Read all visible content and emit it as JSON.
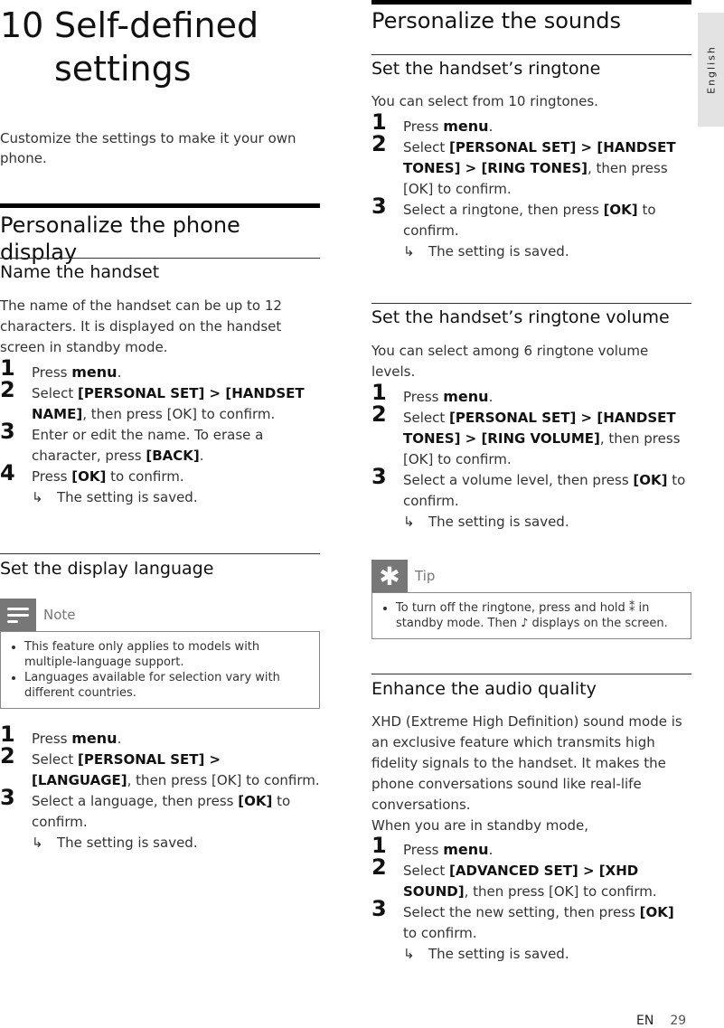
{
  "side_tab": "English",
  "footer": {
    "lang": "EN",
    "page": "29"
  },
  "chapter": {
    "number": "10",
    "title": "Self-defined settings",
    "intro": "Customize the settings to make it your own phone."
  },
  "display": {
    "heading": "Personalize the phone display",
    "name_handset": {
      "heading": "Name the handset",
      "desc": "The name of the handset can be up to 12 characters. It is displayed on the handset screen in standby mode.",
      "steps": [
        {
          "n": "1",
          "pre": "Press ",
          "key": "menu",
          "post": "."
        },
        {
          "n": "2",
          "pre": "Select ",
          "key": "[PERSONAL SET] > [HANDSET NAME]",
          "post": ", then press [OK] to confirm."
        },
        {
          "n": "3",
          "pre": "Enter or edit the name. To erase a character, press ",
          "key": "[BACK]",
          "post": "."
        },
        {
          "n": "4",
          "pre": "Press ",
          "key": "[OK]",
          "post": " to confirm."
        }
      ],
      "result": "The setting is saved."
    },
    "language": {
      "heading": "Set the display language",
      "note_label": "Note",
      "notes": [
        "This feature only applies to models with multiple-language support.",
        "Languages available for selection vary with different countries."
      ],
      "steps": [
        {
          "n": "1",
          "pre": "Press ",
          "key": "menu",
          "post": "."
        },
        {
          "n": "2",
          "pre": "Select ",
          "key": "[PERSONAL SET] > [LANGUAGE]",
          "post": ", then press [OK] to confirm."
        },
        {
          "n": "3",
          "pre": "Select a language, then press ",
          "key": "[OK]",
          "post": " to confirm."
        }
      ],
      "result": "The setting is saved."
    }
  },
  "sounds": {
    "heading": "Personalize the sounds",
    "ringtone": {
      "heading": "Set the handset’s ringtone",
      "desc": "You can select from 10 ringtones.",
      "steps": [
        {
          "n": "1",
          "pre": "Press ",
          "key": "menu",
          "post": "."
        },
        {
          "n": "2",
          "pre": "Select ",
          "key": "[PERSONAL SET] > [HANDSET TONES] > [RING TONES]",
          "post": ", then press [OK] to confirm."
        },
        {
          "n": "3",
          "pre": "Select a ringtone, then press ",
          "key": "[OK]",
          "post": " to confirm."
        }
      ],
      "result": "The setting is saved."
    },
    "volume": {
      "heading": "Set the handset’s ringtone volume",
      "desc": "You can select among 6 ringtone volume levels.",
      "steps": [
        {
          "n": "1",
          "pre": "Press ",
          "key": "menu",
          "post": "."
        },
        {
          "n": "2",
          "pre": "Select ",
          "key": "[PERSONAL SET] > [HANDSET TONES] > [RING VOLUME]",
          "post": ", then press [OK] to confirm."
        },
        {
          "n": "3",
          "pre": "Select a volume level, then press ",
          "key": "[OK]",
          "post": " to confirm."
        }
      ],
      "result": "The setting is saved.",
      "tip_label": "Tip",
      "tip": "To turn off the ringtone, press and hold ⁑ in standby mode. Then ♪ displays on the screen."
    },
    "audio": {
      "heading": "Enhance the audio quality",
      "desc": "XHD (Extreme High Definition) sound mode is an exclusive feature which transmits high fidelity signals to the handset. It makes the phone conversations sound like real-life conversations.",
      "desc2": "When you are in standby mode,",
      "steps": [
        {
          "n": "1",
          "pre": "Press ",
          "key": "menu",
          "post": "."
        },
        {
          "n": "2",
          "pre": "Select ",
          "key": "[ADVANCED SET] > [XHD SOUND]",
          "post": ", then press [OK] to confirm."
        },
        {
          "n": "3",
          "pre": "Select the new setting, then press ",
          "key": "[OK]",
          "post": " to confirm."
        }
      ],
      "result": "The setting is saved."
    }
  }
}
